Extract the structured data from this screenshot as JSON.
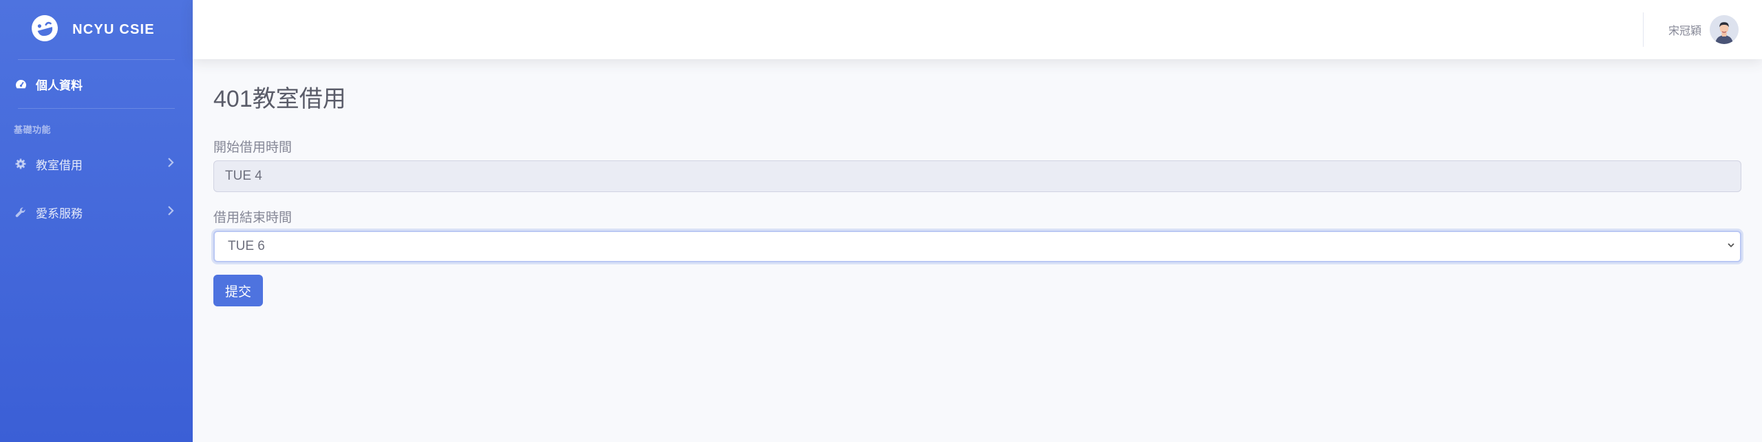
{
  "sidebar": {
    "brand": {
      "text": "NCYU CSIE",
      "icon": "laugh-wink-icon"
    },
    "profile_item": {
      "label": "個人資料",
      "icon": "tachometer-icon"
    },
    "heading": "基礎功能",
    "items": [
      {
        "label": "教室借用",
        "icon": "gear-icon"
      },
      {
        "label": "愛系服務",
        "icon": "wrench-icon"
      }
    ]
  },
  "topbar": {
    "user_name": "宋冠穎",
    "avatar_icon": "user-avatar-icon"
  },
  "main": {
    "title": "401教室借用",
    "start_label": "開始借用時間",
    "start_value": "TUE 4",
    "end_label": "借用結束時間",
    "end_value": "TUE 6",
    "submit_label": "提交"
  },
  "colors": {
    "sidebar_top": "#4e73df",
    "sidebar_bottom": "#3b5fd6",
    "primary": "#4e73df",
    "background": "#f8f9fc"
  }
}
